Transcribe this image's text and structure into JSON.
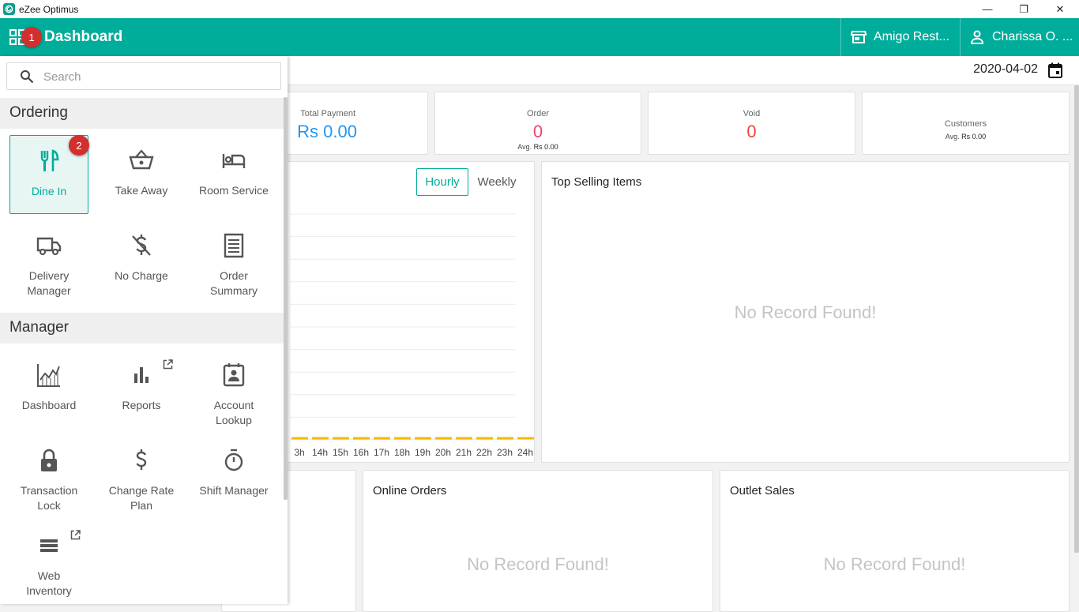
{
  "app": {
    "title": "eZee Optimus",
    "icon": "app-logo-icon"
  },
  "window_controls": {
    "minimize": "—",
    "restore": "❐",
    "close": "✕"
  },
  "header": {
    "title": "Dashboard",
    "outlet": "Amigo Rest...",
    "user": "Charissa O. ...",
    "accent": "#00ad9a"
  },
  "badges": {
    "first": "1",
    "second": "2",
    "color": "#d32f2f"
  },
  "date": "2020-04-02",
  "stats": {
    "total_payment": {
      "label": "Total Payment",
      "value": "Rs 0.00",
      "color": "#2196f3"
    },
    "order": {
      "label": "Order",
      "value": "0",
      "avg_label": "Avg.",
      "avg_value": "Rs 0.00",
      "color": "#f0436a"
    },
    "void": {
      "label": "Void",
      "value": "0",
      "color": "#f44336"
    },
    "customers": {
      "label": "Customers",
      "avg_label": "Avg.",
      "avg_value": "Rs 0.00"
    }
  },
  "sales_chart": {
    "tabs": {
      "hourly": "Hourly",
      "weekly": "Weekly"
    },
    "x_labels": [
      "3h",
      "14h",
      "15h",
      "16h",
      "17h",
      "18h",
      "19h",
      "20h",
      "21h",
      "22h",
      "23h",
      "24h"
    ],
    "line_color": "#f5b800"
  },
  "chart_data": {
    "type": "line",
    "x": [
      "3h",
      "14h",
      "15h",
      "16h",
      "17h",
      "18h",
      "19h",
      "20h",
      "21h",
      "22h",
      "23h",
      "24h"
    ],
    "series": [
      {
        "values": [
          0,
          0,
          0,
          0,
          0,
          0,
          0,
          0,
          0,
          0,
          0,
          0
        ]
      }
    ],
    "grid": true
  },
  "panels": {
    "top_selling": {
      "title": "Top Selling Items",
      "empty": "No Record Found!"
    },
    "online_orders": {
      "title": "Online Orders",
      "empty": "No Record Found!"
    },
    "outlet_sales": {
      "title": "Outlet Sales",
      "empty": "No Record Found!"
    }
  },
  "sidebar": {
    "search_placeholder": "Search",
    "ordering": {
      "title": "Ordering",
      "items": [
        {
          "label": "Dine In",
          "icon": "fork-knife-icon"
        },
        {
          "label": "Take Away",
          "icon": "basket-icon"
        },
        {
          "label": "Room Service",
          "icon": "bed-icon"
        },
        {
          "label_line1": "Delivery",
          "label_line2": "Manager",
          "icon": "truck-icon"
        },
        {
          "label": "No Charge",
          "icon": "no-money-icon"
        },
        {
          "label_line1": "Order",
          "label_line2": "Summary",
          "icon": "receipt-icon"
        }
      ]
    },
    "manager": {
      "title": "Manager",
      "items": [
        {
          "label": "Dashboard",
          "icon": "line-chart-icon"
        },
        {
          "label": "Reports",
          "icon": "bar-chart-icon"
        },
        {
          "label_line1": "Account",
          "label_line2": "Lookup",
          "icon": "contact-card-icon"
        },
        {
          "label_line1": "Transaction",
          "label_line2": "Lock",
          "icon": "lock-icon"
        },
        {
          "label_line1": "Change Rate",
          "label_line2": "Plan",
          "icon": "dollar-icon"
        },
        {
          "label": "Shift Manager",
          "icon": "stopwatch-icon"
        },
        {
          "label_line1": "Web",
          "label_line2": "Inventory",
          "icon": "list-icon"
        }
      ]
    }
  }
}
